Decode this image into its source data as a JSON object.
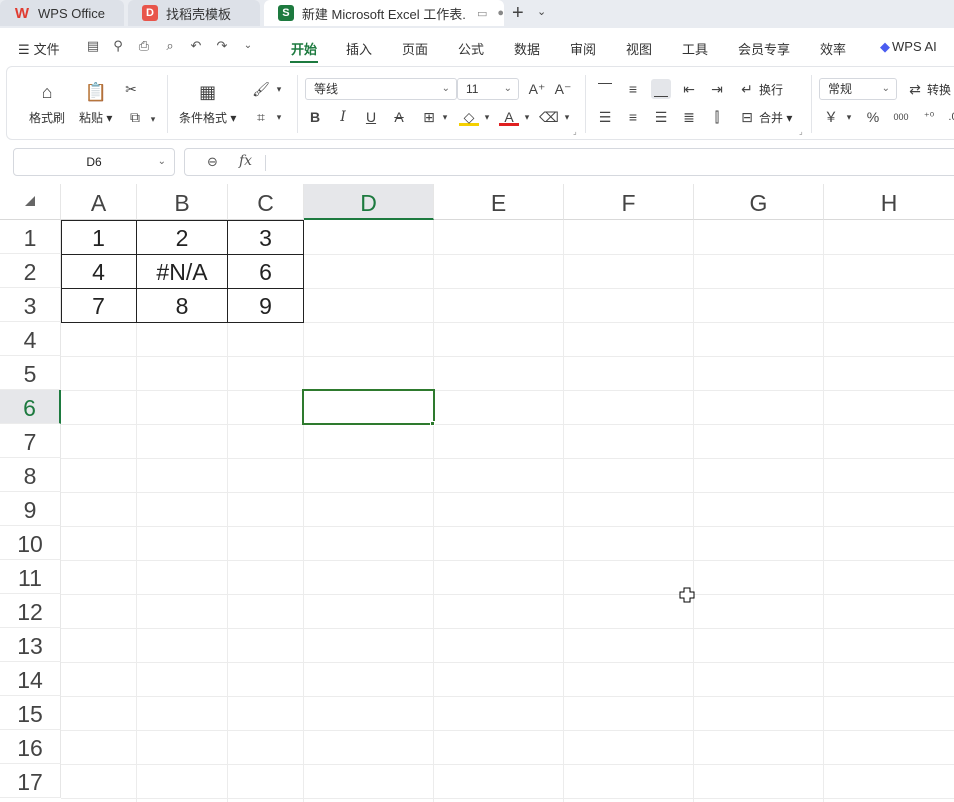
{
  "tabs": [
    {
      "label": "WPS Office",
      "icon": "wps-logo-icon",
      "color": "#e03c31"
    },
    {
      "label": "找稻壳模板",
      "icon": "docer-icon",
      "color": "#e8554b"
    },
    {
      "label": "新建 Microsoft Excel 工作表.",
      "icon": "spreadsheet-icon",
      "color": "#1d7a3f"
    }
  ],
  "menu": {
    "file_label": "文件",
    "items": [
      "开始",
      "插入",
      "页面",
      "公式",
      "数据",
      "审阅",
      "视图",
      "工具",
      "会员专享",
      "效率"
    ],
    "active_item": "开始",
    "ai_label": "WPS AI"
  },
  "ribbon": {
    "format_painter": "格式刷",
    "paste": "粘贴",
    "conditional_format": "条件格式",
    "font_name": "等线",
    "font_size": "11",
    "wrap_text": "换行",
    "merge": "合并",
    "number_format": "常规",
    "convert": "转换",
    "currency_symbol": "￥",
    "percent_symbol": "%",
    "thousands_symbol": "000"
  },
  "formula_bar": {
    "name_box": "D6",
    "fx_label": "fx",
    "formula": ""
  },
  "sheet": {
    "columns": [
      "A",
      "B",
      "C",
      "D",
      "E",
      "F",
      "G",
      "H"
    ],
    "rows": [
      "1",
      "2",
      "3",
      "4",
      "5",
      "6",
      "7",
      "8",
      "9",
      "10",
      "11",
      "12",
      "13",
      "14",
      "15",
      "16",
      "17"
    ],
    "active_column": "D",
    "active_row": "6",
    "cells": {
      "A1": "1",
      "B1": "2",
      "C1": "3",
      "A2": "4",
      "B2": "#N/A",
      "C2": "6",
      "A3": "7",
      "B3": "8",
      "C3": "9"
    }
  },
  "colors": {
    "accent": "#1d7a3f",
    "selection": "#2e7a2e"
  }
}
